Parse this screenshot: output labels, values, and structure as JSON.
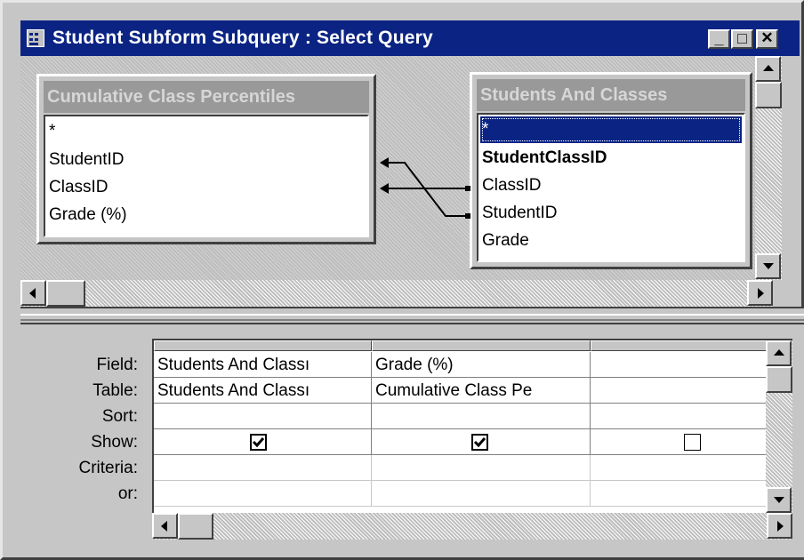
{
  "window": {
    "title": "Student Subform Subquery : Select Query",
    "minimize_glyph": "_",
    "maximize_glyph": "□",
    "close_glyph": "✕"
  },
  "tables": [
    {
      "name": "Cumulative Class Percentiles",
      "fields": [
        "*",
        "StudentID",
        "ClassID",
        "Grade (%)"
      ]
    },
    {
      "name": "Students And Classes",
      "fields": [
        "*",
        "StudentClassID",
        "ClassID",
        "StudentID",
        "Grade"
      ],
      "selected_field": "*",
      "primary_key": "StudentClassID"
    }
  ],
  "joins": [
    {
      "from": "Students And Classes.ClassID",
      "to": "Cumulative Class Percentiles.StudentID"
    },
    {
      "from": "Students And Classes.StudentID",
      "to": "Cumulative Class Percentiles.ClassID"
    }
  ],
  "grid": {
    "row_labels": [
      "Field:",
      "Table:",
      "Sort:",
      "Show:",
      "Criteria:",
      "or:"
    ],
    "columns": [
      {
        "field": "Students And Classı",
        "table": "Students And Classı",
        "sort": "",
        "show": true,
        "criteria": "",
        "or": ""
      },
      {
        "field": "Grade (%)",
        "table": "Cumulative Class Pe",
        "sort": "",
        "show": true,
        "criteria": "",
        "or": ""
      },
      {
        "field": "",
        "table": "",
        "sort": "",
        "show": false,
        "criteria": "",
        "or": ""
      }
    ]
  },
  "colors": {
    "titlebar": "#0b2483",
    "face": "#c6c6c6",
    "selection": "#0b2483"
  },
  "icons": [
    "query-icon",
    "scroll-up-icon",
    "scroll-down-icon",
    "scroll-left-icon",
    "scroll-right-icon",
    "checkbox-icon"
  ]
}
